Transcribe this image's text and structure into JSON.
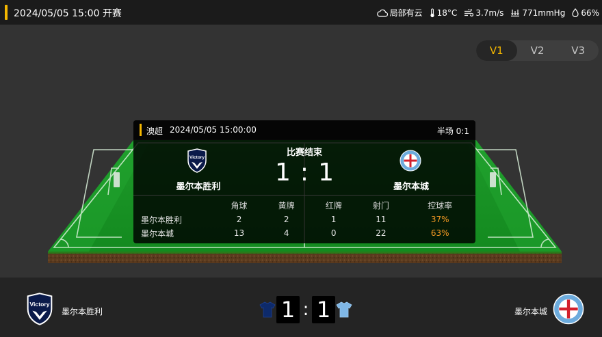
{
  "header": {
    "datetime_status": "2024/05/05 15:00 开赛",
    "weather": {
      "condition": "局部有云",
      "temperature": "18°C",
      "wind": "3.7m/s",
      "pressure": "771mmHg",
      "humidity": "66%"
    }
  },
  "version_toggle": {
    "options": [
      "V1",
      "V2",
      "V3"
    ],
    "selected": "V1"
  },
  "card": {
    "league": "澳超",
    "datetime": "2024/05/05 15:00:00",
    "halftime": "半场 0:1",
    "status": "比赛结束",
    "home_name": "墨尔本胜利",
    "away_name": "墨尔本城",
    "home_score": "1",
    "away_score": "1",
    "score_separator": ":",
    "stats_headers": [
      "角球",
      "黄牌",
      "红牌",
      "射门",
      "控球率"
    ],
    "stats_rows": [
      {
        "team": "墨尔本胜利",
        "corners": "2",
        "yellow": "2",
        "red": "1",
        "shots": "11",
        "possession": "37%"
      },
      {
        "team": "墨尔本城",
        "corners": "13",
        "yellow": "4",
        "red": "0",
        "shots": "22",
        "possession": "63%"
      }
    ]
  },
  "bottom": {
    "home_name": "墨尔本胜利",
    "away_name": "墨尔本城",
    "home_score": "1",
    "away_score": "1",
    "separator": ":"
  },
  "colors": {
    "accent": "#f5b800",
    "possession": "#f59a23",
    "home_shirt": "#0d2a6b",
    "away_shirt": "#7fb7e6"
  },
  "icons": {
    "weather": "cloud-icon",
    "temperature": "thermometer-icon",
    "wind": "wind-icon",
    "pressure": "pressure-icon",
    "humidity": "droplet-icon"
  }
}
